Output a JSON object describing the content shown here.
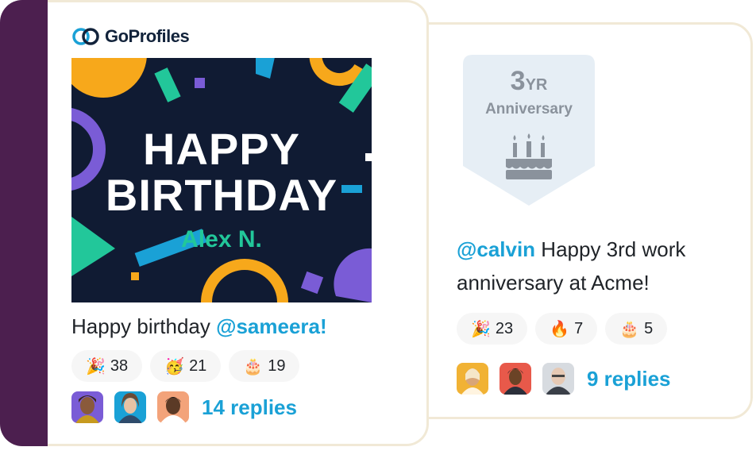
{
  "anniversary_card": {
    "badge_years_number": "3",
    "badge_years_unit": "YR",
    "badge_label": "Anniversary",
    "mention": "@calvin",
    "message": " Happy 3rd work anniversary at Acme!",
    "reactions": [
      {
        "emoji": "🎉",
        "count": "23"
      },
      {
        "emoji": "🔥",
        "count": "7"
      },
      {
        "emoji": "🎂",
        "count": "5"
      }
    ],
    "replies": "9 replies"
  },
  "birthday_card": {
    "logo": "GoProfiles",
    "banner_line1": "HAPPY",
    "banner_line2": "BIRTHDAY",
    "banner_name": "Alex N.",
    "message_prefix": "Happy birthday ",
    "mention": "@sameera!",
    "reactions": [
      {
        "emoji": "🎉",
        "count": "38"
      },
      {
        "emoji": "🥳",
        "count": "21"
      },
      {
        "emoji": "🎂",
        "count": "19"
      }
    ],
    "replies": "14 replies"
  },
  "colors": {
    "accent": "#1aa1d6",
    "sidebar": "#4c1f4f",
    "banner_bg": "#101b33",
    "banner_name": "#22c79a",
    "card_border": "#f1e9d6"
  }
}
